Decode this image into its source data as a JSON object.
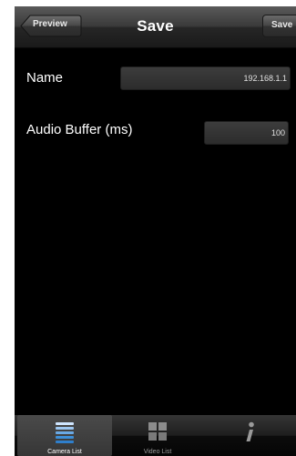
{
  "navbar": {
    "title": "Save",
    "back_label": "Preview",
    "right_label": "Save"
  },
  "form": {
    "name_label": "Name",
    "name_value": "192.168.1.1",
    "buffer_label": "Audio Buffer (ms)",
    "buffer_value": "100"
  },
  "tabbar": {
    "tabs": [
      {
        "label": "Camera List",
        "icon": "list-icon",
        "active": true
      },
      {
        "label": "Video List",
        "icon": "grid-icon",
        "active": false
      },
      {
        "label": "",
        "icon": "info-icon",
        "active": false
      }
    ]
  }
}
